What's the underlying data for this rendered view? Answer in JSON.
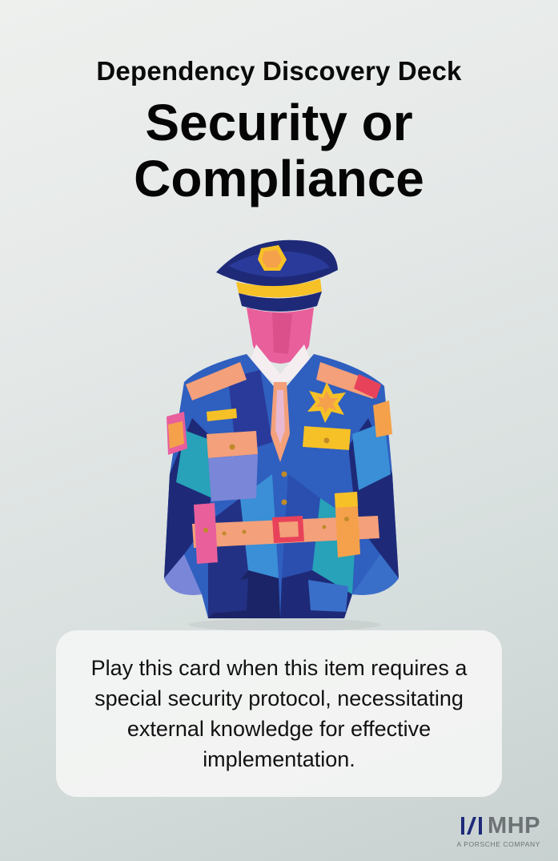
{
  "card": {
    "deck_title": "Dependency Discovery Deck",
    "title": "Security or\nCompliance",
    "description": "Play this card when this item requires  a special security protocol, necessitating external knowledge for effective implementation."
  },
  "illustration": {
    "subject": "paper-collage-police-officer",
    "colors": {
      "navy": "#1e2a78",
      "blue": "#2f5fbf",
      "light_blue": "#3a8fd6",
      "teal": "#27a2b8",
      "pink": "#e85f9c",
      "orange": "#f5a14b",
      "yellow": "#f6c126",
      "peach": "#f4a07a"
    }
  },
  "logo": {
    "text": "MHP",
    "subtitle": "A PORSCHE COMPANY",
    "icon": "mhp-logo-icon",
    "color": "#6d7275"
  }
}
